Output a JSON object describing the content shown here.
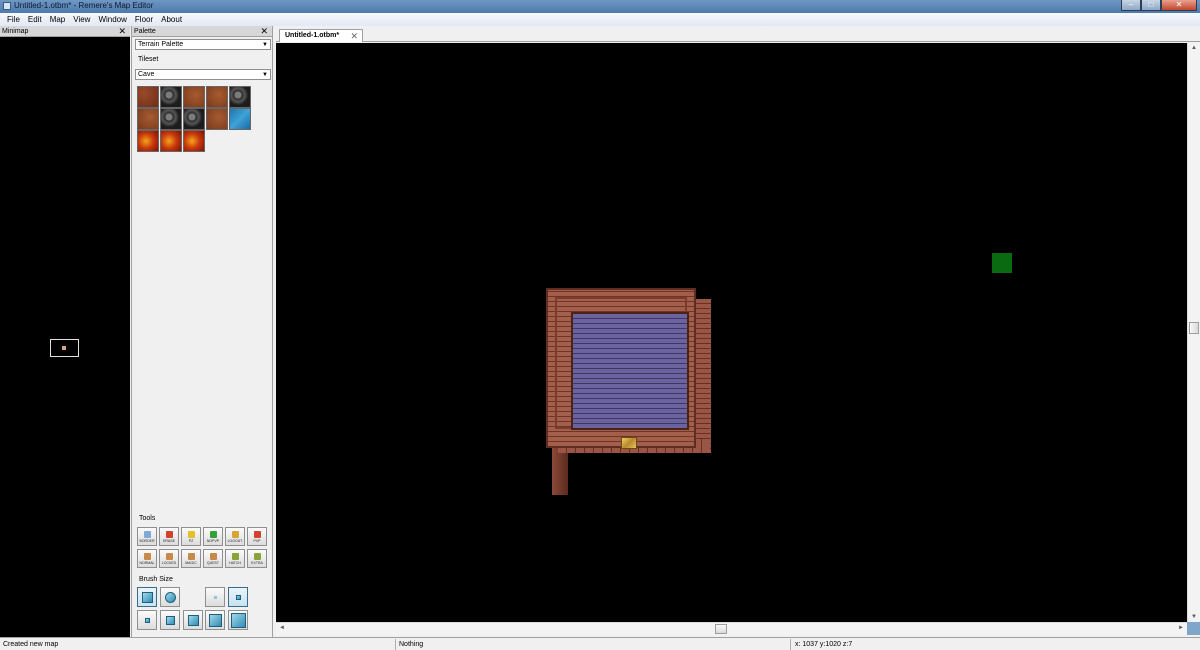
{
  "window": {
    "title": "Untitled-1.otbm* - Remere's Map Editor",
    "minimize": "–",
    "maximize": "□",
    "close": "✕"
  },
  "menu": [
    "File",
    "Edit",
    "Map",
    "View",
    "Window",
    "Floor",
    "About"
  ],
  "minimap": {
    "title": "Minimap",
    "close": "✕"
  },
  "palette": {
    "title": "Palette",
    "close": "✕",
    "palette_type": "Terrain Palette",
    "tileset_label": "Tileset",
    "tileset_value": "Cave",
    "tiles": [
      "dirt",
      "rock",
      "dirt2",
      "dirt2",
      "rock",
      "dirt2",
      "rock",
      "rock",
      "dirt2",
      "water",
      "lava",
      "lava",
      "lava"
    ],
    "tools_label": "Tools",
    "tools": [
      {
        "label": "BORDER",
        "icon": "border-icon",
        "color": "#7fa9d6"
      },
      {
        "label": "ERASE",
        "icon": "eraser-icon",
        "color": "#d6402f"
      },
      {
        "label": "PZ",
        "icon": "pz-icon",
        "color": "#e3c12a"
      },
      {
        "label": "NOPVP",
        "icon": "nopvp-icon",
        "color": "#34a13a"
      },
      {
        "label": "LOGOUT",
        "icon": "logout-icon",
        "color": "#d9a437"
      },
      {
        "label": "PVP",
        "icon": "pvp-icon",
        "color": "#d6402f"
      },
      {
        "label": "NORMAL",
        "icon": "door-normal-icon",
        "color": "#c88a4b"
      },
      {
        "label": "LOCKED",
        "icon": "door-locked-icon",
        "color": "#c88a4b"
      },
      {
        "label": "MAGIC",
        "icon": "door-magic-icon",
        "color": "#c88a4b"
      },
      {
        "label": "QUEST",
        "icon": "door-quest-icon",
        "color": "#c88a4b"
      },
      {
        "label": "HATCH",
        "icon": "hatch-icon",
        "color": "#8aa43a"
      },
      {
        "label": "EXTRA",
        "icon": "extra-icon",
        "color": "#8aa43a"
      }
    ],
    "brush_label": "Brush Size"
  },
  "tab": {
    "label": "Untitled-1.otbm*",
    "close": "✕"
  },
  "status": {
    "message": "Created new map",
    "hover": "Nothing",
    "position": "x: 1037 y:1020 z:7"
  },
  "colors": {
    "canvas": "#000000",
    "marker": "#0a6a12",
    "titlebar": "#5a85b8"
  }
}
